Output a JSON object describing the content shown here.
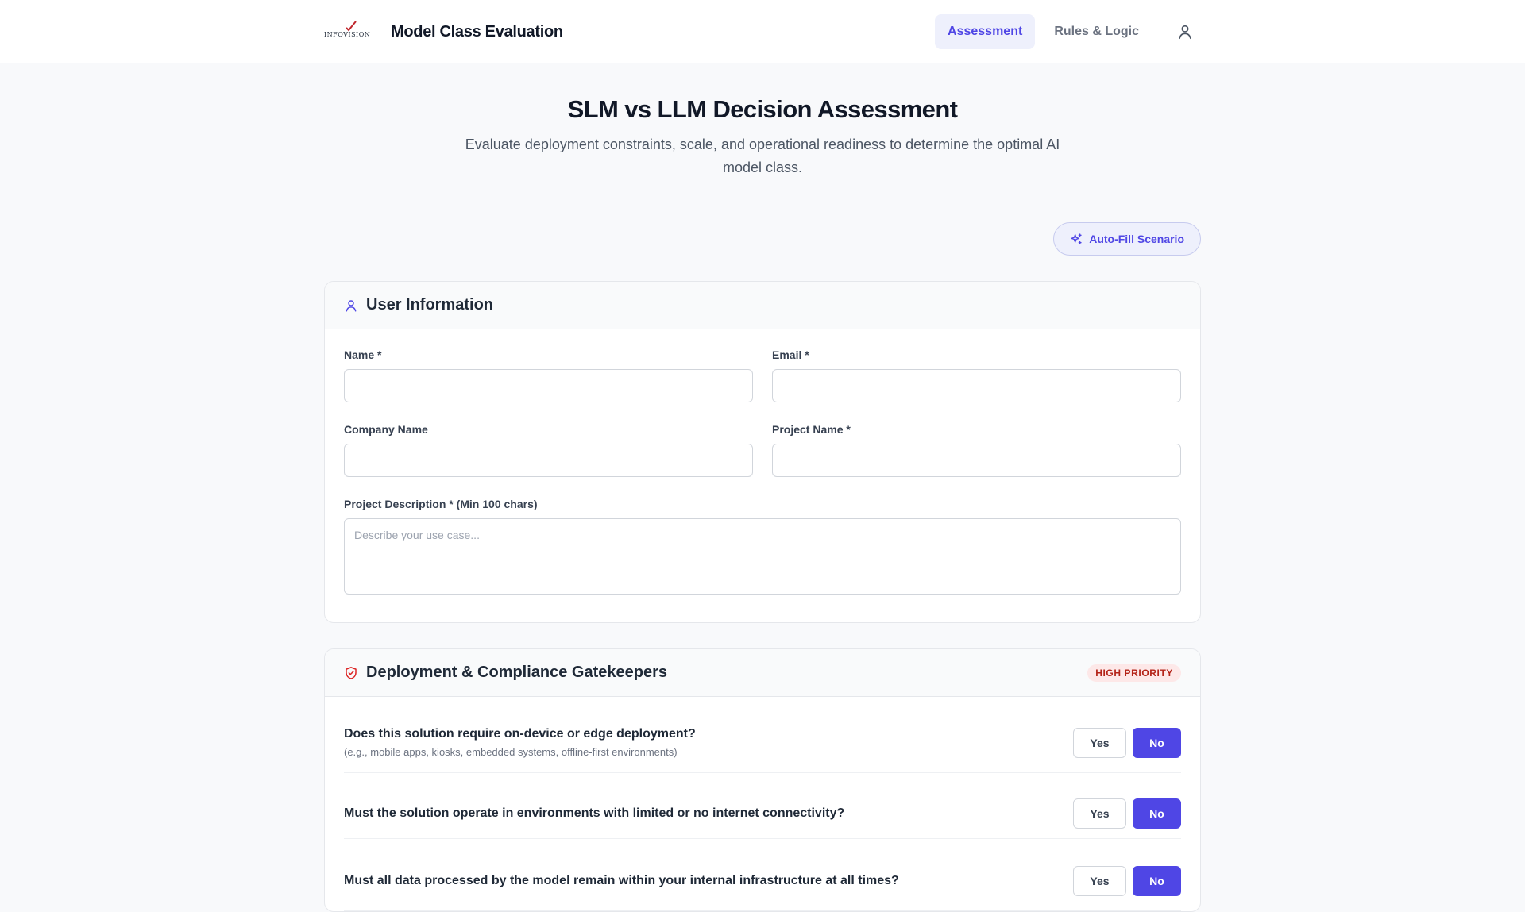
{
  "header": {
    "logo_text": "INFOVISION",
    "app_title": "Model Class Evaluation",
    "nav": [
      {
        "label": "Assessment",
        "active": true
      },
      {
        "label": "Rules & Logic",
        "active": false
      }
    ],
    "profile_icon": "user-icon"
  },
  "page": {
    "title": "SLM vs LLM Decision Assessment",
    "subtitle": "Evaluate deployment constraints, scale, and operational readiness to determine the optimal AI model class.",
    "autofill_label": "Auto-Fill Scenario"
  },
  "user_info": {
    "title": "User Information",
    "icon": "user-icon",
    "fields": {
      "name": {
        "label": "Name *",
        "value": "",
        "placeholder": ""
      },
      "email": {
        "label": "Email *",
        "value": "",
        "placeholder": ""
      },
      "company": {
        "label": "Company Name",
        "value": "",
        "placeholder": ""
      },
      "project": {
        "label": "Project Name *",
        "value": "",
        "placeholder": ""
      },
      "description": {
        "label": "Project Description * (Min 100 chars)",
        "value": "",
        "placeholder": "Describe your use case..."
      }
    }
  },
  "gatekeepers": {
    "title": "Deployment & Compliance Gatekeepers",
    "icon": "shield-icon",
    "badge": "HIGH PRIORITY",
    "yes_label": "Yes",
    "no_label": "No",
    "questions": [
      {
        "title": "Does this solution require on-device or edge deployment?",
        "hint": "(e.g., mobile apps, kiosks, embedded systems, offline-first environments)",
        "selected": "No"
      },
      {
        "title": "Must the solution operate in environments with limited or no internet connectivity?",
        "hint": "",
        "selected": "No"
      },
      {
        "title": "Must all data processed by the model remain within your internal infrastructure at all times?",
        "hint": "",
        "selected": "No"
      }
    ]
  },
  "colors": {
    "accent": "#4f46e5",
    "accent_soft": "#eef0fc",
    "badge_bg": "#fde8e8",
    "badge_text": "#b42318",
    "shield_icon": "#dc2626"
  }
}
